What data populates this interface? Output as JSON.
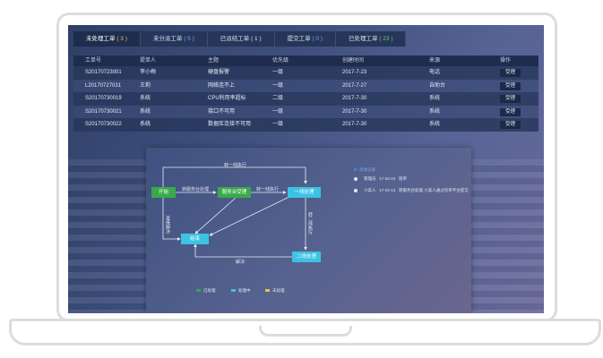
{
  "tabs": [
    {
      "label": "未处理工单",
      "count": "( 3 )",
      "tone": "yellow"
    },
    {
      "label": "未分派工单",
      "count": "( 5 )",
      "tone": "blue"
    },
    {
      "label": "已派结工单",
      "count": "( 1 )",
      "tone": "plain"
    },
    {
      "label": "提交工单",
      "count": "( 0 )",
      "tone": "blue"
    },
    {
      "label": "已处理工单",
      "count": "( 23 )",
      "tone": "green"
    }
  ],
  "table": {
    "headers": [
      "工单号",
      "提单人",
      "主题",
      "优先级",
      "创建时间",
      "来源",
      "操作"
    ],
    "rows": [
      {
        "id": "S20170723001",
        "submitter": "李小梅",
        "subject": "硬盘报警",
        "priority": "一级",
        "created": "2017-7-23",
        "source": "电话",
        "action": "受理"
      },
      {
        "id": "L20170727031",
        "submitter": "王莉",
        "subject": "网络连不上",
        "priority": "一级",
        "created": "2017-7-27",
        "source": "自助台",
        "action": "受理"
      },
      {
        "id": "S20170730019",
        "submitter": "系统",
        "subject": "CPU利用率超标",
        "priority": "二级",
        "created": "2017-7-30",
        "source": "系统",
        "action": "受理"
      },
      {
        "id": "S20170730021",
        "submitter": "系统",
        "subject": "接口不可用",
        "priority": "一级",
        "created": "2017-7-30",
        "source": "系统",
        "action": "受理"
      },
      {
        "id": "S20170730022",
        "submitter": "系统",
        "subject": "数据库连接不可用",
        "priority": "一级",
        "created": "2017-7-30",
        "source": "系统",
        "action": "受理"
      }
    ]
  },
  "diagram": {
    "nodes": {
      "start": "开始",
      "service_desk": "服务台受理",
      "tier1": "一线处理",
      "tier2": "二线处理",
      "close": "结束"
    },
    "edges": {
      "top": "转一线执行",
      "start_to_desk": "转服务台处理",
      "desk_to_tier1": "转一线执行",
      "tier1_to_tier2": "转二线执行",
      "start_to_close": "直接解决",
      "tier2_to_close": "解决"
    },
    "timeline": {
      "title": "流动记录",
      "entries": [
        {
          "user": "管理员",
          "date": "17-03-24",
          "note": "接单"
        },
        {
          "user": "小美人",
          "date": "17-03-13",
          "note": "转服务台处理 小美人通过热单平台提交"
        }
      ]
    },
    "legend": [
      {
        "label": "已处理",
        "color": "#39a94a"
      },
      {
        "label": "处理中",
        "color": "#3cc3e3"
      },
      {
        "label": "未处理",
        "color": "#e0c64a"
      }
    ]
  }
}
